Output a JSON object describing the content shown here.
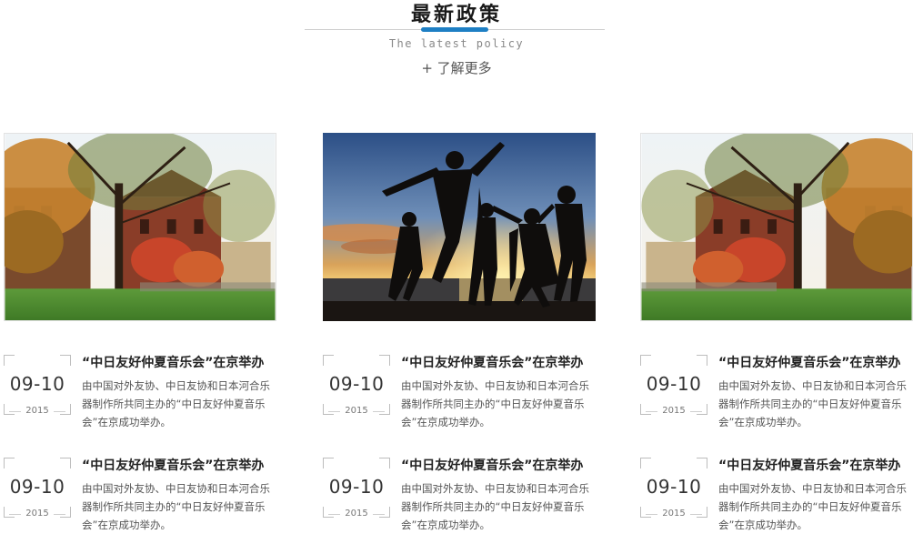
{
  "header": {
    "title": "最新政策",
    "subtitle": "The latest policy",
    "more_link": "+ 了解更多"
  },
  "colors": {
    "accent": "#1e7fc4",
    "title": "#1a1a1a",
    "body_text": "#555555"
  },
  "columns": [
    {
      "image": "autumn-campus-tree-photo",
      "items": [
        {
          "date": "09-10",
          "year": "2015",
          "title": "“中日友好仲夏音乐会”在京举办",
          "desc": "由中国对外友协、中日友协和日本河合乐器制作所共同主办的“中日友好仲夏音乐会”在京成功举办。"
        },
        {
          "date": "09-10",
          "year": "2015",
          "title": "“中日友好仲夏音乐会”在京举办",
          "desc": "由中国对外友协、中日友协和日本河合乐器制作所共同主办的“中日友好仲夏音乐会”在京成功举办。"
        }
      ]
    },
    {
      "image": "beach-sunset-jumping-silhouettes-photo",
      "items": [
        {
          "date": "09-10",
          "year": "2015",
          "title": "“中日友好仲夏音乐会”在京举办",
          "desc": "由中国对外友协、中日友协和日本河合乐器制作所共同主办的“中日友好仲夏音乐会”在京成功举办。"
        },
        {
          "date": "09-10",
          "year": "2015",
          "title": "“中日友好仲夏音乐会”在京举办",
          "desc": "由中国对外友协、中日友协和日本河合乐器制作所共同主办的“中日友好仲夏音乐会”在京成功举办。"
        }
      ]
    },
    {
      "image": "autumn-campus-tree-photo",
      "items": [
        {
          "date": "09-10",
          "year": "2015",
          "title": "“中日友好仲夏音乐会”在京举办",
          "desc": "由中国对外友协、中日友协和日本河合乐器制作所共同主办的“中日友好仲夏音乐会”在京成功举办。"
        },
        {
          "date": "09-10",
          "year": "2015",
          "title": "“中日友好仲夏音乐会”在京举办",
          "desc": "由中国对外友协、中日友协和日本河合乐器制作所共同主办的“中日友好仲夏音乐会”在京成功举办。"
        }
      ]
    }
  ]
}
